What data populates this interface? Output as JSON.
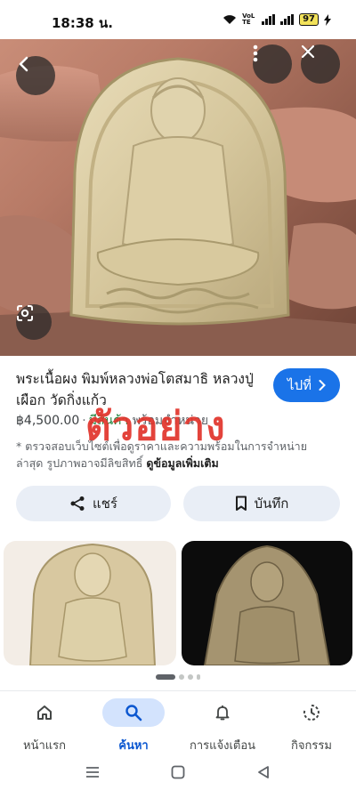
{
  "status": {
    "time": "18:38 น.",
    "network_label": "VoLTE",
    "battery": "97"
  },
  "hero": {
    "back_icon": "arrow-left-icon",
    "more_icon": "more-vert-icon",
    "close_icon": "close-icon",
    "lens_icon": "lens-icon"
  },
  "result": {
    "title": "พระเนื้อผง พิมพ์หลวงพ่อโตสมาธิ หลวงปู่เผือก วัดกิ่งแก้ว",
    "goto_label": "ไปที่",
    "price": "฿4,500.00",
    "stock": "มีสินค้า",
    "stock_rest": "พร้อมจำหน่าย",
    "watermark": "ตัวอย่าง",
    "disclaimer": "* ตรวจสอบเว็บไซต์เพื่อดูราคาและความพร้อมในการจำหน่ายล่าสุด รูปภาพอาจมีลิขสิทธิ์",
    "more_link": "ดูข้อมูลเพิ่มเติม"
  },
  "actions": {
    "share": "แชร์",
    "save": "บันทึก"
  },
  "bottom_nav": [
    {
      "label": "หน้าแรก",
      "icon": "home-icon"
    },
    {
      "label": "ค้นหา",
      "icon": "search-icon"
    },
    {
      "label": "การแจ้งเตือน",
      "icon": "bell-icon"
    },
    {
      "label": "กิจกรรม",
      "icon": "activity-icon"
    }
  ],
  "colors": {
    "accent": "#1a73e8",
    "watermark": "#e1342b",
    "stock": "#188038"
  }
}
